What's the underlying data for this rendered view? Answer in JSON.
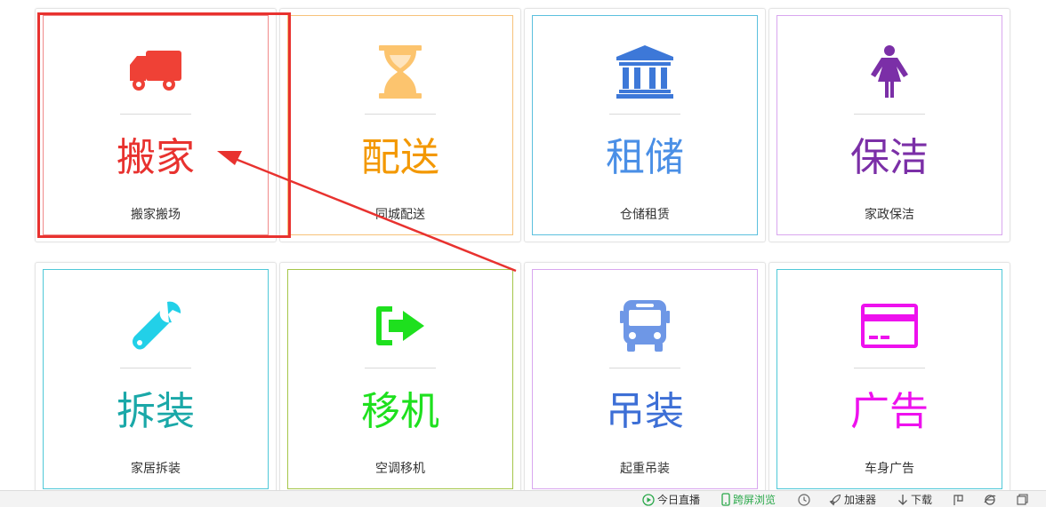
{
  "cards": [
    {
      "title": "搬家",
      "subtitle": "搬家搬场",
      "color": "#e8322f",
      "icon": "truck-icon"
    },
    {
      "title": "配送",
      "subtitle": "同城配送",
      "color": "#f39800",
      "icon": "hourglass-icon"
    },
    {
      "title": "租储",
      "subtitle": "仓储租赁",
      "color": "#4a8fe6",
      "icon": "bank-icon"
    },
    {
      "title": "保洁",
      "subtitle": "家政保洁",
      "color": "#7b2fa7",
      "icon": "female-icon"
    },
    {
      "title": "拆装",
      "subtitle": "家居拆装",
      "color": "#1aa8a8",
      "icon": "wrench-icon"
    },
    {
      "title": "移机",
      "subtitle": "空调移机",
      "color": "#1ee01e",
      "icon": "sign-out-icon"
    },
    {
      "title": "吊装",
      "subtitle": "起重吊装",
      "color": "#3d6fd6",
      "icon": "bus-icon"
    },
    {
      "title": "广告",
      "subtitle": "车身广告",
      "color": "#ee11ee",
      "icon": "credit-card-icon"
    }
  ],
  "statusbar": {
    "live": "今日直播",
    "mirror": "跨屏浏览",
    "accelerator": "加速器",
    "download": "下载"
  }
}
